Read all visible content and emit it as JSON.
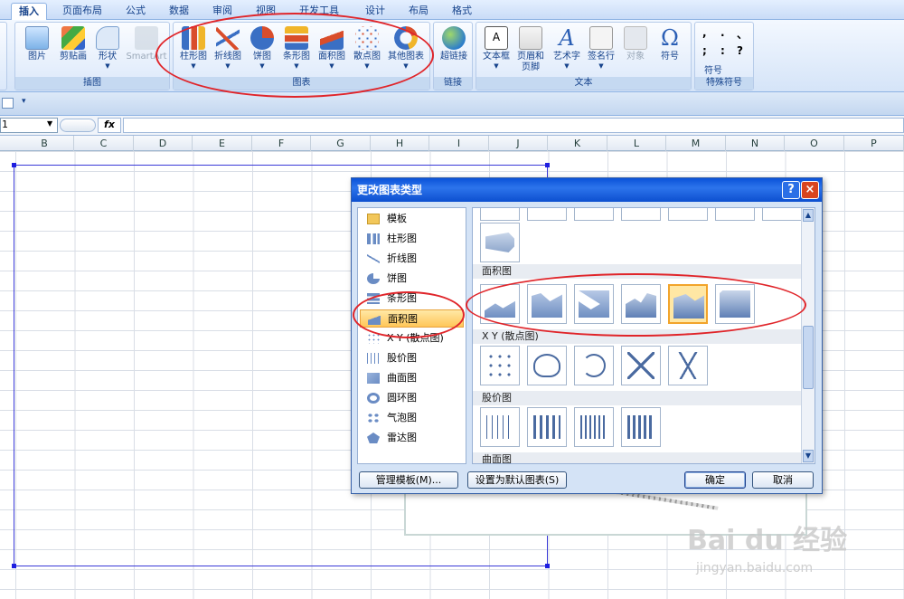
{
  "tabs": [
    "插入",
    "页面布局",
    "公式",
    "数据",
    "审阅",
    "视图",
    "开发工具",
    "设计",
    "布局",
    "格式"
  ],
  "ribbon": {
    "groups": {
      "illustrations": "插图",
      "charts": "图表",
      "links": "链接",
      "text": "文本",
      "symbols": "特殊符号"
    },
    "buttons": {
      "picture": "图片",
      "clipart": "剪贴画",
      "shapes": "形状",
      "smartart": "SmartArt",
      "column": "柱形图",
      "line": "折线图",
      "pie": "饼图",
      "bar": "条形图",
      "area": "面积图",
      "scatter": "散点图",
      "other": "其他图表",
      "hyperlink": "超链接",
      "textbox": "文本框",
      "header_footer_1": "页眉和",
      "header_footer_2": "页脚",
      "wordart": "艺术字",
      "signature": "签名行",
      "object": "对象",
      "symbol": "符号",
      "special_symbol": "符号"
    },
    "symbols": [
      ",",
      ".",
      "、",
      ";",
      ":",
      "?"
    ]
  },
  "formula_bar": {
    "name_box": "1",
    "fx": "fx"
  },
  "columns": [
    "B",
    "C",
    "D",
    "E",
    "F",
    "G",
    "H",
    "I",
    "J",
    "K",
    "L",
    "M",
    "N",
    "O",
    "P"
  ],
  "dialog": {
    "title": "更改图表类型",
    "help": "?",
    "close": "×",
    "categories": [
      "模板",
      "柱形图",
      "折线图",
      "饼图",
      "条形图",
      "面积图",
      "X Y (散点图)",
      "股价图",
      "曲面图",
      "圆环图",
      "气泡图",
      "雷达图"
    ],
    "selected_category": "面积图",
    "sections": {
      "area": "面积图",
      "scatter": "X Y (散点图)",
      "stock": "股价图",
      "surface": "曲面图"
    },
    "buttons": {
      "manage": "管理模板(M)...",
      "set_default": "设置为默认图表(S)",
      "ok": "确定",
      "cancel": "取消"
    }
  },
  "watermark": {
    "brand": "Bai du 经验",
    "url": "jingyan.baidu.com"
  },
  "accent": "#e0252a"
}
